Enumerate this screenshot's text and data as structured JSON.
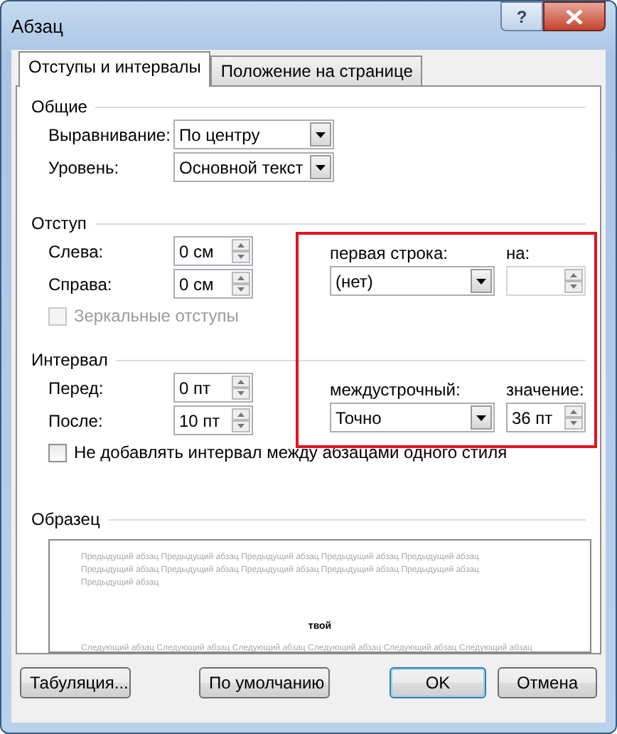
{
  "window": {
    "title": "Абзац",
    "help": "?"
  },
  "tabs": [
    {
      "label": "Отступы и интервалы",
      "selected": true
    },
    {
      "label": "Положение на странице",
      "selected": false
    }
  ],
  "general": {
    "title": "Общие",
    "fields": [
      {
        "label": "Выравнивание:",
        "value": "По центру"
      },
      {
        "label": "Уровень:",
        "value": "Основной текст"
      }
    ]
  },
  "indent": {
    "title": "Отступ",
    "fields": [
      {
        "label": "Слева:",
        "value": "0 см"
      },
      {
        "label": "Справа:",
        "value": "0 см"
      }
    ],
    "mirror": {
      "label": "Зеркальные отступы",
      "checked": false,
      "disabled": true
    },
    "first_line": {
      "label": "первая строка:",
      "value": "(нет)"
    },
    "by": {
      "label": "на:",
      "disabled": true
    }
  },
  "spacing": {
    "title": "Интервал",
    "fields": [
      {
        "label": "Перед:",
        "value": "0 пт"
      },
      {
        "label": "После:",
        "value": "10 пт"
      }
    ],
    "line_spacing": {
      "label": "междустрочный:",
      "value": "Точно"
    },
    "at": {
      "label": "значение:",
      "value": "36 пт",
      "disabled": false
    },
    "no_space": {
      "label": "Не добавлять интервал между абзацами одного стиля",
      "checked": false,
      "disabled": false
    }
  },
  "preview": {
    "title": "Образец",
    "previous": [
      "Предыдущий абзац Предыдущий абзац Предыдущий абзац Предыдущий абзац Предыдущий абзац",
      "Предыдущий абзац Предыдущий абзац Предыдущий абзац Предыдущий абзац Предыдущий абзац",
      "Предыдущий абзац"
    ],
    "sample": "твой",
    "next": [
      "Следующий абзац Следующий абзац Следующий абзац Следующий абзац Следующий абзац Следующий абзац"
    ]
  },
  "buttons": [
    {
      "label": "Табуляция...",
      "default": false
    },
    {
      "label": "По умолчанию",
      "default": false
    },
    {
      "label": "OK",
      "default": true
    },
    {
      "label": "Отмена",
      "default": false
    }
  ]
}
